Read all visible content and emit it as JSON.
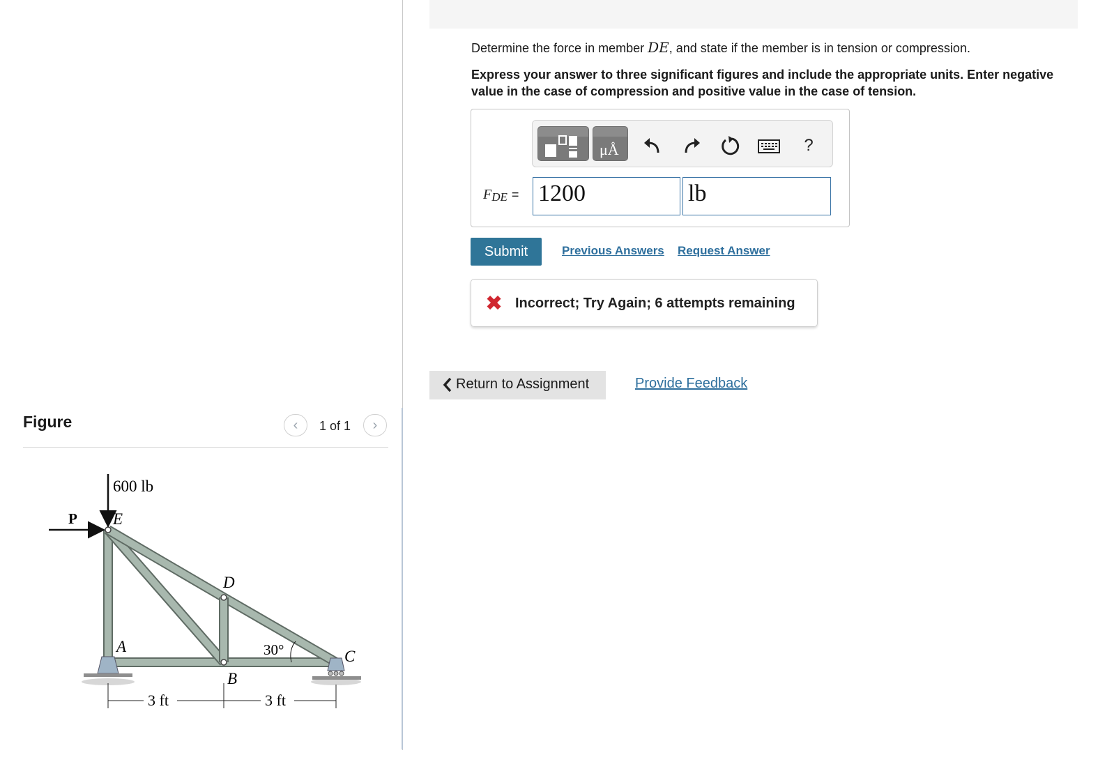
{
  "question": {
    "prefix": "Determine the force in member ",
    "member": "DE",
    "suffix": ", and state if the member is in tension or compression.",
    "instructions": "Express your answer to three significant figures and include the appropriate units. Enter negative value in the case of compression and positive value in the case of tension."
  },
  "answer": {
    "label_main": "F",
    "label_sub": "DE",
    "equals": "=",
    "value": "1200",
    "unit": "lb"
  },
  "toolbar": {
    "units_button_label": "μÅ",
    "help_label": "?",
    "icons": [
      "templates-icon",
      "units-icon",
      "undo-icon",
      "redo-icon",
      "reset-icon",
      "keyboard-icon",
      "help-icon"
    ]
  },
  "actions": {
    "submit_label": "Submit",
    "previous_answers_label": "Previous Answers",
    "request_answer_label": "Request Answer"
  },
  "feedback": {
    "status_icon": "x-icon",
    "message": "Incorrect; Try Again; 6 attempts remaining"
  },
  "navigation": {
    "return_label": "Return to Assignment",
    "provide_feedback_label": "Provide Feedback"
  },
  "figure": {
    "title": "Figure",
    "pager": "1 of 1",
    "labels": {
      "load": "600 lb",
      "force_p": "P",
      "joint_e": "E",
      "joint_d": "D",
      "joint_a": "A",
      "joint_b": "B",
      "joint_c": "C",
      "angle": "30°",
      "dim_left": "3 ft",
      "dim_right": "3 ft"
    }
  },
  "colors": {
    "accent": "#2f7598",
    "link": "#2e6f9d",
    "error": "#d0262f",
    "input_border": "#3a74a6",
    "member_fill": "#a8b8ae"
  }
}
